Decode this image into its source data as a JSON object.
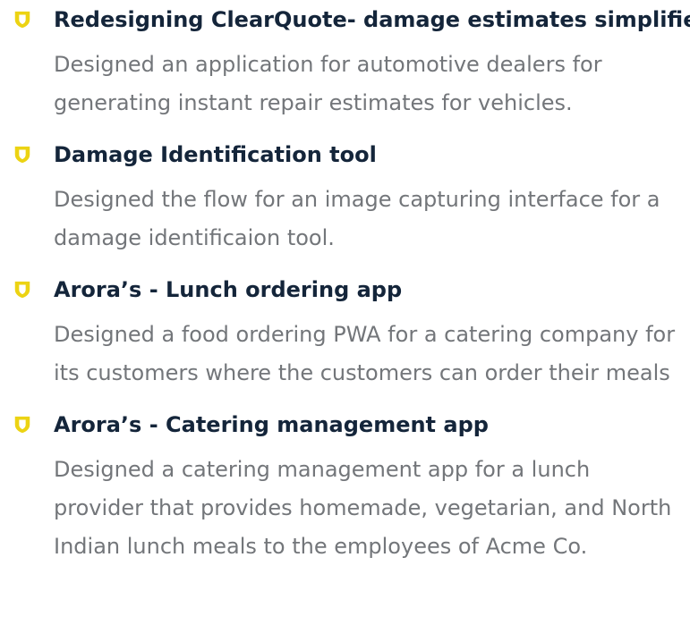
{
  "colors": {
    "accent": "#ecd313",
    "title": "#14253a",
    "description": "#73767a"
  },
  "icon": "shield-icon",
  "projects": [
    {
      "title": "Redesigning ClearQuote- damage estimates simplified",
      "description": "Designed an application for automotive dealers for generating instant repair estimates for vehicles."
    },
    {
      "title": "Damage Identification tool",
      "description": "Designed the flow for an image capturing interface for a damage identificaion tool."
    },
    {
      "title": "Arora’s - Lunch ordering app",
      "description": "Designed a food ordering PWA for a catering company for its customers where the customers can order their meals"
    },
    {
      "title": "Arora’s - Catering management app",
      "description": "Designed a catering management app for a lunch provider that provides homemade, vegetarian, and North Indian lunch meals to the employees of Acme Co."
    }
  ]
}
